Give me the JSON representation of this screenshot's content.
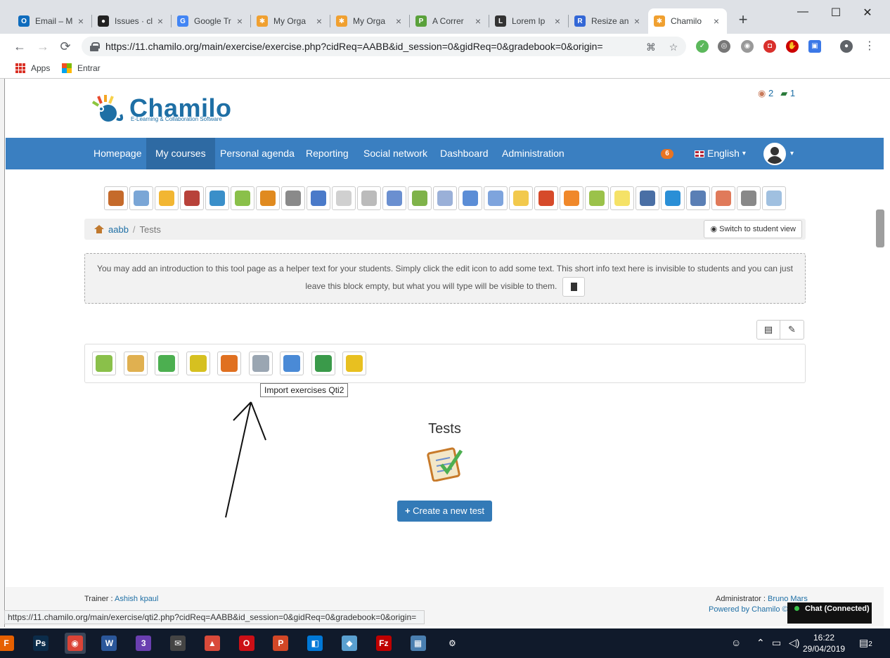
{
  "browser": {
    "tabs": [
      {
        "label": "Email – M",
        "favicon": "outlook-icon",
        "color": "#0f6cbd",
        "glyph": "O"
      },
      {
        "label": "Issues · cl",
        "favicon": "github-icon",
        "color": "#222222",
        "glyph": "●"
      },
      {
        "label": "Google Tr",
        "favicon": "google-translate-icon",
        "color": "#4285f4",
        "glyph": "G"
      },
      {
        "label": "My Orga",
        "favicon": "chamilo-icon",
        "color": "#f0a030",
        "glyph": "✱"
      },
      {
        "label": "My Orga",
        "favicon": "chamilo-icon",
        "color": "#f0a030",
        "glyph": "✱"
      },
      {
        "label": "A Correr",
        "favicon": "pen-icon",
        "color": "#5aa13b",
        "glyph": "P"
      },
      {
        "label": "Lorem Ip",
        "favicon": "lorem-icon",
        "color": "#333333",
        "glyph": "L"
      },
      {
        "label": "Resize an",
        "favicon": "resize-icon",
        "color": "#3367d6",
        "glyph": "R"
      },
      {
        "label": "Chamilo",
        "favicon": "chamilo-icon",
        "color": "#f0a030",
        "glyph": "✱",
        "active": true
      }
    ],
    "tab_close": "×",
    "new_tab": "+",
    "window_controls": {
      "minimize": "—",
      "maximize": "☐",
      "close": "✕"
    },
    "nav": {
      "back": "←",
      "forward": "→",
      "reload": "⟳"
    },
    "url": "https://11.chamilo.org/main/exercise/exercise.php?cidReq=AABB&id_session=0&gidReq=0&gradebook=0&origin=",
    "bookmarks": [
      {
        "label": "Apps",
        "icon": "apps-grid-icon"
      },
      {
        "label": "Entrar",
        "icon": "microsoft-icon"
      }
    ],
    "status_url": "https://11.chamilo.org/main/exercise/qti2.php?cidReq=AABB&id_session=0&gidReq=0&gradebook=0&origin="
  },
  "site": {
    "logo_text": "Chamilo",
    "logo_sub": "E-Learning & Collaboration Software",
    "top_users_count": "2",
    "top_teachers_count": "1",
    "menu": [
      {
        "label": "Homepage"
      },
      {
        "label": "My courses",
        "active": true
      },
      {
        "label": "Personal agenda"
      },
      {
        "label": "Reporting"
      },
      {
        "label": "Social network"
      },
      {
        "label": "Dashboard"
      },
      {
        "label": "Administration"
      }
    ],
    "notifications_count": "6",
    "language": "English",
    "caret": "▾"
  },
  "course_tools": [
    {
      "icon": "home-icon",
      "color": "#c56a2b"
    },
    {
      "icon": "description-icon",
      "color": "#7aa6d6"
    },
    {
      "icon": "documents-folder-icon",
      "color": "#f2b632"
    },
    {
      "icon": "learning-path-icon",
      "color": "#b8423a"
    },
    {
      "icon": "links-globe-icon",
      "color": "#3a8fc9"
    },
    {
      "icon": "tests-icon",
      "color": "#8ac04a"
    },
    {
      "icon": "announcements-bell-icon",
      "color": "#e08a1f"
    },
    {
      "icon": "gradebook-icon",
      "color": "#8a8a8a"
    },
    {
      "icon": "glossary-abc-icon",
      "color": "#4a7ac9"
    },
    {
      "icon": "attendance-clock-icon",
      "color": "#d0d0d0"
    },
    {
      "icon": "wiki-book-icon",
      "color": "#bbbbbb"
    },
    {
      "icon": "calendar-icon",
      "color": "#6a8fd0"
    },
    {
      "icon": "users-add-icon",
      "color": "#7fb34a"
    },
    {
      "icon": "dropbox-mail-icon",
      "color": "#9ab0d8"
    },
    {
      "icon": "user-icon",
      "color": "#5b8dd6"
    },
    {
      "icon": "groups-icon",
      "color": "#7ea4dd"
    },
    {
      "icon": "chat-bubble-icon",
      "color": "#f2c94c"
    },
    {
      "icon": "assignments-pencil-icon",
      "color": "#d64a2a"
    },
    {
      "icon": "surveys-ball-icon",
      "color": "#f0882a"
    },
    {
      "icon": "notebook-icon",
      "color": "#9bc24a"
    },
    {
      "icon": "notes-icon",
      "color": "#f5e267"
    },
    {
      "icon": "laptop-icon",
      "color": "#4a6fa5"
    },
    {
      "icon": "videoconference-screen-icon",
      "color": "#2a8fd6"
    },
    {
      "icon": "blog-icon",
      "color": "#5a7fb5"
    },
    {
      "icon": "cards-icon",
      "color": "#e07a5a"
    },
    {
      "icon": "settings-tools-icon",
      "color": "#888888"
    },
    {
      "icon": "backup-disc-icon",
      "color": "#a0c0e0"
    }
  ],
  "breadcrumb": {
    "course": "aabb",
    "separator": "/",
    "current": "Tests"
  },
  "switch_student_view": "Switch to student view",
  "intro_text": "You may add an introduction to this tool page as a helper text for your students. Simply click the edit icon to add some text. This short info text here is invisible to students and you can just leave this block empty, but what you will type will be visible to them.",
  "exercise_tools": [
    {
      "icon": "new-test-icon",
      "color": "#8ac04a"
    },
    {
      "icon": "question-pool-icon",
      "color": "#e0b050"
    },
    {
      "icon": "folder-icon",
      "color": "#4caf50"
    },
    {
      "icon": "hotpotatoes-icon",
      "color": "#d6c020"
    },
    {
      "icon": "aiken-import-icon",
      "color": "#e07020"
    },
    {
      "icon": "import-qti2-icon",
      "color": "#9aa6b2"
    },
    {
      "icon": "export-qti2-icon",
      "color": "#4a8ad6"
    },
    {
      "icon": "import-excel-icon",
      "color": "#3a9a4a"
    },
    {
      "icon": "clean-results-icon",
      "color": "#e8c020"
    }
  ],
  "tooltip": "Import exercises Qti2",
  "empty_state": {
    "title": "Tests",
    "button": "Create a new test",
    "button_icon": "+"
  },
  "footer": {
    "trainer_label": "Trainer :",
    "trainer_name": "Ashish kpaul",
    "admin_label": "Administrator :",
    "admin_name": "Bruno Mars",
    "powered": "Powered by Chamilo ©",
    "chat": "Chat (Connected)"
  },
  "taskbar": {
    "apps": [
      {
        "icon": "firefox-icon",
        "color": "#e66000",
        "glyph": "F"
      },
      {
        "icon": "photoshop-icon",
        "color": "#0b2c4a",
        "glyph": "Ps"
      },
      {
        "icon": "chrome-icon",
        "color": "#db4437",
        "glyph": "◉",
        "active": true
      },
      {
        "icon": "word-icon",
        "color": "#2b579a",
        "glyph": "W"
      },
      {
        "icon": "app-purple-icon",
        "color": "#6a3fb0",
        "glyph": "3"
      },
      {
        "icon": "mail-icon",
        "color": "#444444",
        "glyph": "✉"
      },
      {
        "icon": "bird-app-icon",
        "color": "#d94a3a",
        "glyph": "▲"
      },
      {
        "icon": "opera-icon",
        "color": "#cc0f16",
        "glyph": "O"
      },
      {
        "icon": "powerpoint-icon",
        "color": "#d24726",
        "glyph": "P"
      },
      {
        "icon": "store-app-icon",
        "color": "#0078d7",
        "glyph": "◧"
      },
      {
        "icon": "notes-app-icon",
        "color": "#5aa0d0",
        "glyph": "◆"
      },
      {
        "icon": "filezilla-icon",
        "color": "#bf0000",
        "glyph": "Fz"
      },
      {
        "icon": "photos-icon",
        "color": "#4a7fb0",
        "glyph": "▦"
      },
      {
        "icon": "settings-gear-icon",
        "color": "#101a2b",
        "glyph": "⚙"
      }
    ],
    "time": "16:22",
    "date": "29/04/2019",
    "notifications": "2"
  }
}
